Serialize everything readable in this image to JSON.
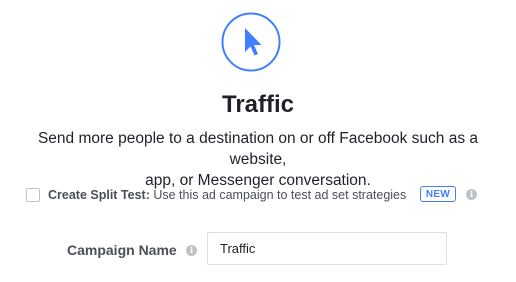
{
  "objective": {
    "icon": "cursor-arrow-icon",
    "title": "Traffic",
    "description_line1": "Send more people to a destination on or off Facebook such as a website,",
    "description_line2": "app, or Messenger conversation."
  },
  "split_test": {
    "checked": false,
    "label": "Create Split Test:",
    "description": " Use this ad campaign to test ad set strategies",
    "badge": "NEW",
    "info_icon": "info-icon"
  },
  "campaign_name": {
    "label": "Campaign Name",
    "info_icon": "info-icon",
    "value": "Traffic"
  },
  "colors": {
    "accent": "#4080ff",
    "text_primary": "#1d2129",
    "text_secondary": "#4b4f56",
    "border": "#dddfe2",
    "info_icon_bg": "#bec2c9"
  }
}
